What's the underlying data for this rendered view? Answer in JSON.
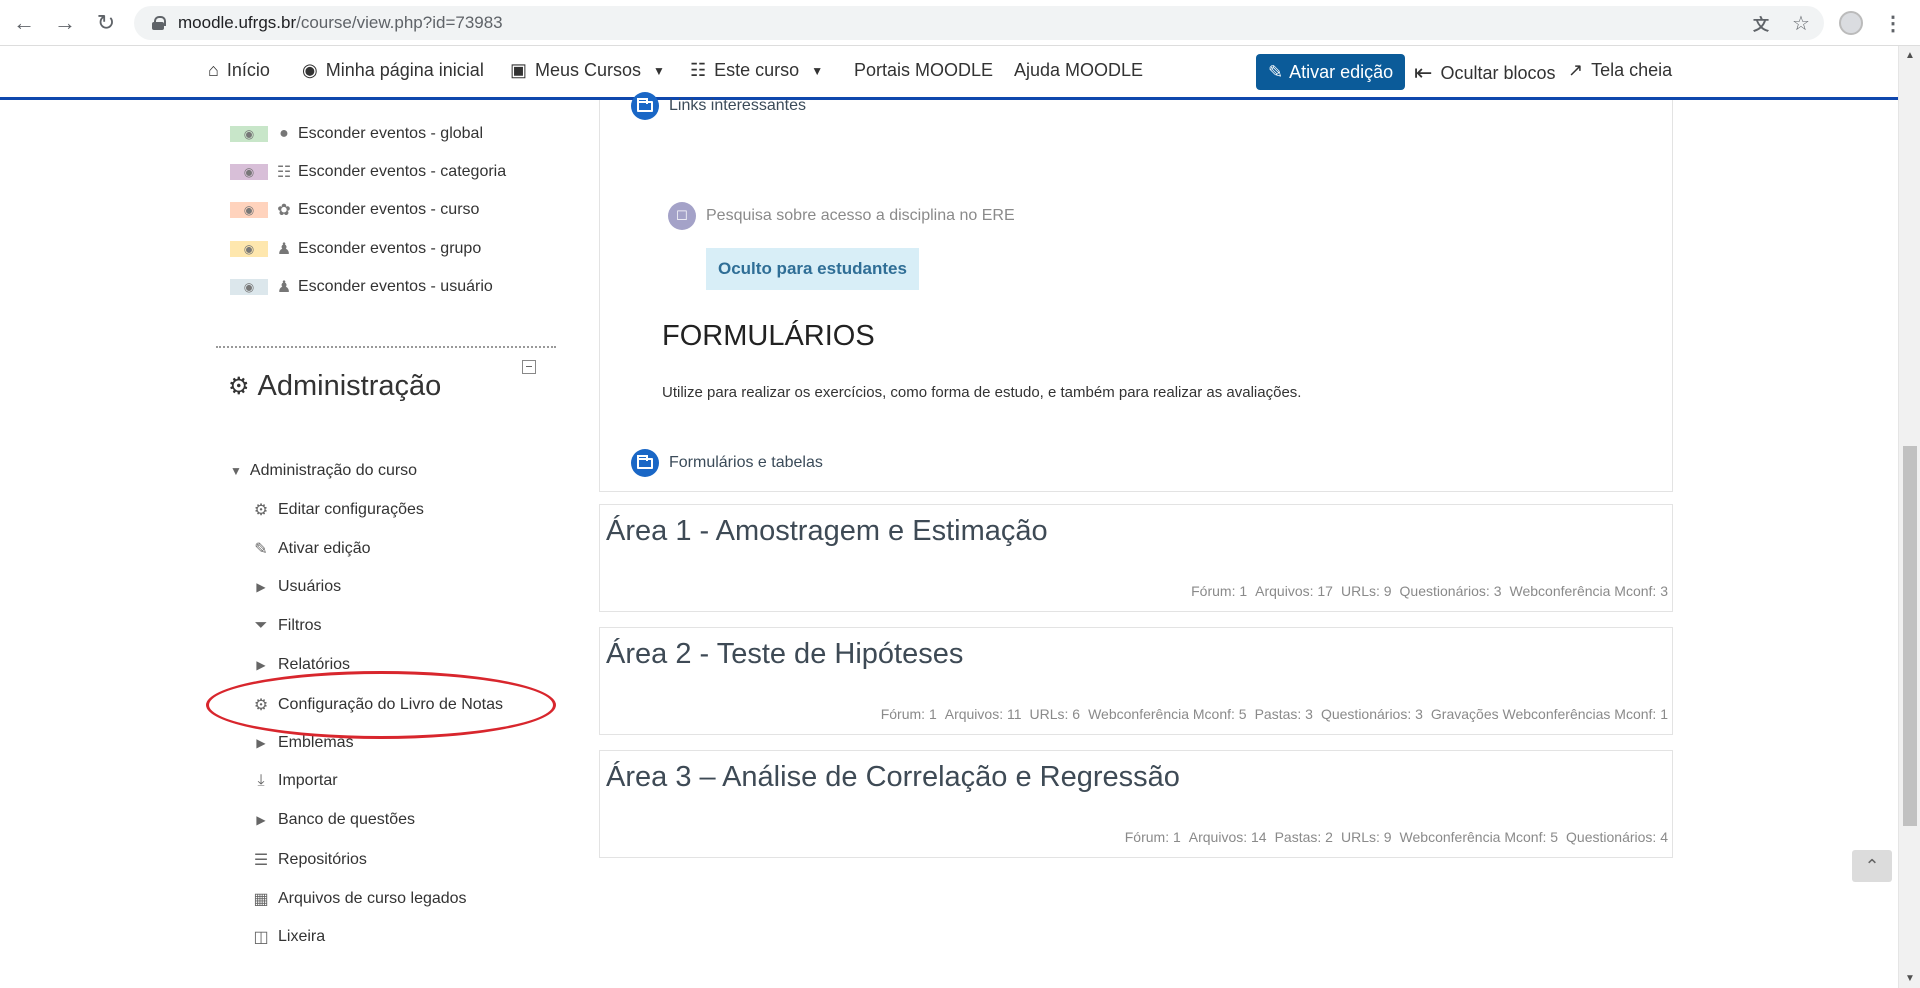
{
  "browser": {
    "url_host": "moodle.ufrgs.br",
    "url_path": "/course/view.php?id=73983"
  },
  "navbar": {
    "items": [
      {
        "label": "Início",
        "icon": "home-icon"
      },
      {
        "label": "Minha página inicial",
        "icon": "dashboard-icon"
      },
      {
        "label": "Meus Cursos",
        "icon": "briefcase-icon"
      },
      {
        "label": "Este curso",
        "icon": "sitemap-icon"
      },
      {
        "label": "Portais MOODLE"
      },
      {
        "label": "Ajuda MOODLE"
      }
    ],
    "edit_button": "Ativar edição",
    "hide_blocks": "Ocultar blocos",
    "fullscreen": "Tela cheia"
  },
  "events_block": {
    "items": [
      {
        "label": "Esconder eventos - global",
        "color": "#c8e6c9"
      },
      {
        "label": "Esconder eventos - categoria",
        "color": "#d8bfd8"
      },
      {
        "label": "Esconder eventos - curso",
        "color": "#ffd3bd"
      },
      {
        "label": "Esconder eventos - grupo",
        "color": "#fee7ae"
      },
      {
        "label": "Esconder eventos - usuário",
        "color": "#dce7ec"
      }
    ]
  },
  "admin": {
    "title": "Administração",
    "root": "Administração do curso",
    "items": [
      {
        "label": "Editar configurações",
        "icon": "gear-icon"
      },
      {
        "label": "Ativar edição",
        "icon": "pencil-icon"
      },
      {
        "label": "Usuários",
        "icon": "caret-right-icon"
      },
      {
        "label": "Filtros",
        "icon": "filter-icon"
      },
      {
        "label": "Relatórios",
        "icon": "caret-right-icon"
      },
      {
        "label": "Configuração do Livro de Notas",
        "icon": "gear-icon"
      },
      {
        "label": "Emblemas",
        "icon": "caret-right-icon"
      },
      {
        "label": "Importar",
        "icon": "import-icon"
      },
      {
        "label": "Banco de questões",
        "icon": "caret-right-icon"
      },
      {
        "label": "Repositórios",
        "icon": "database-icon"
      },
      {
        "label": "Arquivos de curso legados",
        "icon": "folder-icon"
      },
      {
        "label": "Lixeira",
        "icon": "trash-icon"
      }
    ]
  },
  "main": {
    "links_interessantes": "Links interessantes",
    "survey": "Pesquisa sobre acesso a disciplina no ERE",
    "hidden_badge": "Oculto para estudantes",
    "formularios_heading": "FORMULÁRIOS",
    "formularios_text": "Utilize para realizar os exercícios, como forma de estudo, e também para realizar as avaliações.",
    "formularios_folder": "Formulários e tabelas",
    "areas": [
      {
        "title": "Área 1 - Amostragem e Estimação",
        "summary": [
          "Fórum: 1",
          "Arquivos: 17",
          "URLs: 9",
          "Questionários: 3",
          "Webconferência Mconf: 3"
        ]
      },
      {
        "title": "Área 2 - Teste de Hipóteses",
        "summary": [
          "Fórum: 1",
          "Arquivos: 11",
          "URLs: 6",
          "Webconferência Mconf: 5",
          "Pastas: 3",
          "Questionários: 3",
          "Gravações Webconferências Mconf: 1"
        ]
      },
      {
        "title": "Área 3 – Análise de Correlação e Regressão",
        "summary": [
          "Fórum: 1",
          "Arquivos: 14",
          "Pastas: 2",
          "URLs: 9",
          "Webconferência Mconf: 5",
          "Questionários: 4"
        ]
      }
    ]
  },
  "colors": {
    "navbar_border": "#0f47ad",
    "edit_button_bg": "#0b5b99",
    "annotation": "#d8262d",
    "folder_icon": "#1a67c6"
  }
}
